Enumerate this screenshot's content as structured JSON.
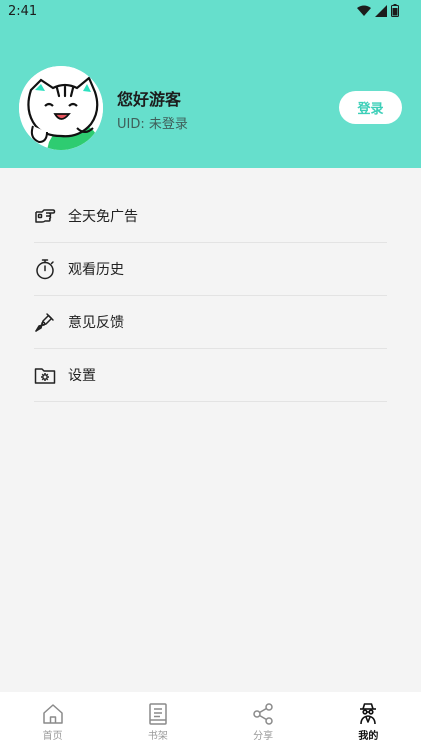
{
  "status_bar": {
    "time": "2:41"
  },
  "profile": {
    "name": "您好游客",
    "uid": "UID: 未登录",
    "login_label": "登录"
  },
  "menu": [
    {
      "label": "全天免广告",
      "icon": "pointing-hand-icon"
    },
    {
      "label": "观看历史",
      "icon": "stopwatch-icon"
    },
    {
      "label": "意见反馈",
      "icon": "pen-nib-icon"
    },
    {
      "label": "设置",
      "icon": "settings-folder-icon"
    }
  ],
  "bottom_nav": [
    {
      "label": "首页",
      "icon": "home-icon",
      "active": false
    },
    {
      "label": "书架",
      "icon": "book-icon",
      "active": false
    },
    {
      "label": "分享",
      "icon": "share-icon",
      "active": false
    },
    {
      "label": "我的",
      "icon": "spy-profile-icon",
      "active": true
    }
  ],
  "colors": {
    "header_bg": "#66dfcc",
    "accent": "#3ccfb8",
    "page_bg": "#f4f4f4"
  }
}
